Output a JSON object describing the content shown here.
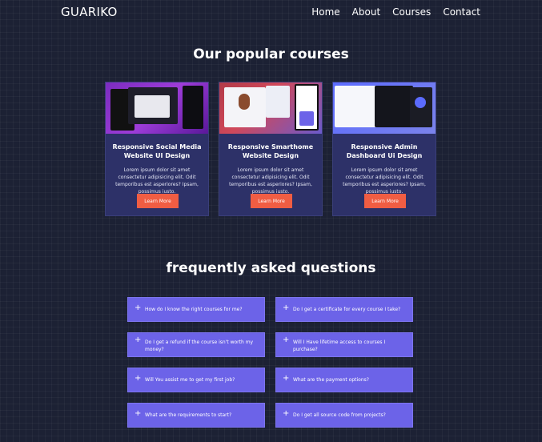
{
  "nav": {
    "logo": "GUARIKO",
    "links": [
      "Home",
      "About",
      "Courses",
      "Contact"
    ]
  },
  "courses": {
    "title": "Our popular courses",
    "items": [
      {
        "title": "Responsive Social Media Website UI Design",
        "text": "Lorem ipsum dolor sit amet consectetur adipisicing elit. Odit temporibus est asperiores? Ipsam, possimus iusto.",
        "button": "Learn More"
      },
      {
        "title": "Responsive Smarthome Website Design",
        "text": "Lorem ipsum dolor sit amet consectetur adipisicing elit. Odit temporibus est asperiores? Ipsam, possimus iusto.",
        "button": "Learn More"
      },
      {
        "title": "Responsive Admin Dashboard Ui Design",
        "text": "Lorem ipsum dolor sit amet consectetur adipisicing elit. Odit temporibus est asperiores? Ipsam, possimus iusto.",
        "button": "Learn More"
      }
    ]
  },
  "faq": {
    "title": "frequently asked questions",
    "items": [
      "How do I know the right courses for me?",
      "Do I get a certificate for every course I take?",
      "Do I get a refund if the course isn't worth my money?",
      "Will I Have lifetime access to courses I purchase?",
      "Will You assist me to get my first job?",
      "What are the payment options?",
      "What are the requirements to start?",
      "Do I get all source code from projects?"
    ]
  },
  "colors": {
    "background": "#1c2134",
    "card": "#2d3168",
    "accent_button": "#f05d43",
    "faq_item": "#6c63e8"
  }
}
